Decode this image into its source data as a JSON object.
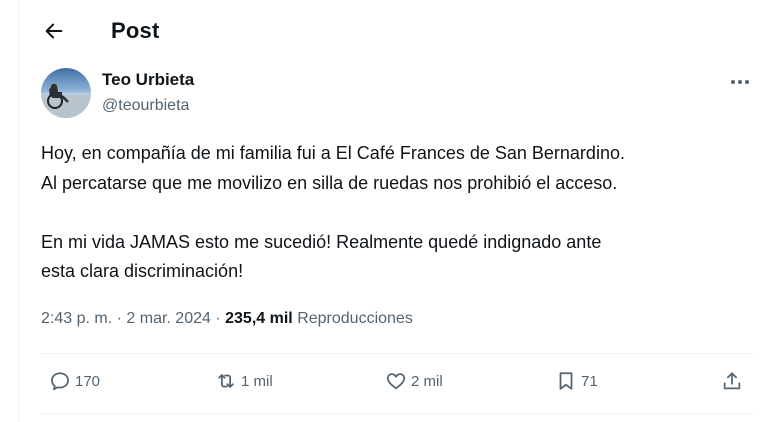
{
  "header": {
    "title": "Post"
  },
  "author": {
    "name": "Teo Urbieta",
    "handle": "@teourbieta"
  },
  "post": {
    "paragraphs": [
      [
        "Hoy, en compañía de mi familia fui a El Café Frances de San Bernardino.",
        "Al percatarse que me movilizo en silla de ruedas nos prohibió el acceso."
      ],
      [
        "En mi vida JAMAS esto me sucedió! Realmente quedé indignado ante",
        "esta clara discriminación!"
      ]
    ]
  },
  "meta": {
    "time": "2:43 p. m.",
    "separator": "·",
    "date": "2 mar. 2024",
    "views_count": "235,4 mil",
    "views_label": "Reproducciones"
  },
  "actions": {
    "replies": "170",
    "reposts": "1 mil",
    "likes": "2 mil",
    "bookmarks": "71"
  },
  "icons": {
    "back": "arrow-left-icon",
    "more": "more-horizontal-icon",
    "reply": "reply-icon",
    "repost": "repost-icon",
    "like": "heart-icon",
    "bookmark": "bookmark-icon",
    "share": "share-icon"
  },
  "colors": {
    "text_primary": "#0f1419",
    "text_secondary": "#536471",
    "divider": "#eff3f4"
  }
}
